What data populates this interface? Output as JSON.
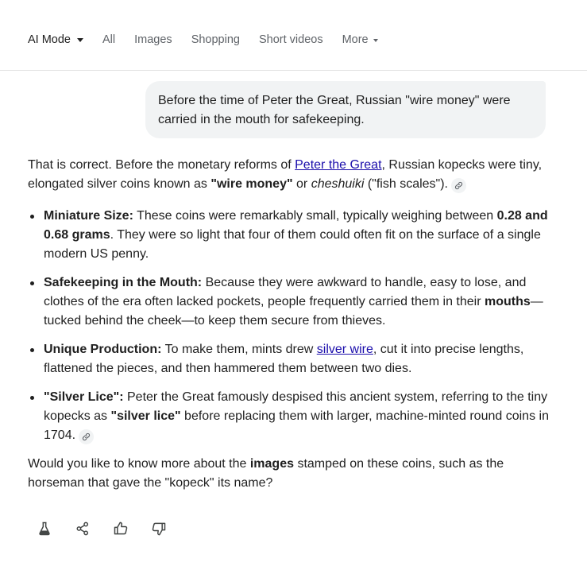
{
  "nav": {
    "items": [
      {
        "label": "AI Mode"
      },
      {
        "label": "All"
      },
      {
        "label": "Images"
      },
      {
        "label": "Shopping"
      },
      {
        "label": "Short videos"
      },
      {
        "label": "More"
      }
    ]
  },
  "query": {
    "text": "Before the time of Peter the Great, Russian \"wire money\" were carried in the mouth for safekeeping."
  },
  "answer": {
    "intro": {
      "t1": "That is correct. Before the monetary reforms of ",
      "link": "Peter the Great",
      "t2": ", Russian kopecks were tiny, elongated silver coins known as ",
      "bold": "\"wire money\"",
      "t3": " or ",
      "italic": "cheshuiki",
      "t4": " (\"fish scales\")."
    },
    "bullets": [
      {
        "title": "Miniature Size:",
        "t1": " These coins were remarkably small, typically weighing between ",
        "bold": "0.28 and 0.68 grams",
        "t2": ". They were so light that four of them could often fit on the surface of a single modern US penny."
      },
      {
        "title": "Safekeeping in the Mouth:",
        "t1": " Because they were awkward to handle, easy to lose, and clothes of the era often lacked pockets, people frequently carried them in their ",
        "bold": "mouths",
        "t2": "—tucked behind the cheek—to keep them secure from thieves."
      },
      {
        "title": "Unique Production:",
        "t1": " To make them, mints drew ",
        "link": "silver wire",
        "t2": ", cut it into precise lengths, flattened the pieces, and then hammered them between two dies."
      },
      {
        "title": "\"Silver Lice\":",
        "t1": " Peter the Great famously despised this ancient system, referring to the tiny kopecks as ",
        "bold": "\"silver lice\"",
        "t2": " before replacing them with larger, machine-minted round coins in 1704."
      }
    ],
    "closing": {
      "t1": "Would you like to know more about the ",
      "bold": "images",
      "t2": " stamped on these coins, such as the horseman that gave the \"kopeck\" its name?"
    }
  },
  "icons": {
    "citation": "link-icon",
    "actions": [
      "flask-icon",
      "share-icon",
      "thumbs-up-icon",
      "thumbs-down-icon"
    ]
  },
  "colors": {
    "link": "#1a0dab",
    "bubble_bg": "#f1f3f4",
    "text": "#1f1f1f",
    "muted": "#5f6368"
  }
}
